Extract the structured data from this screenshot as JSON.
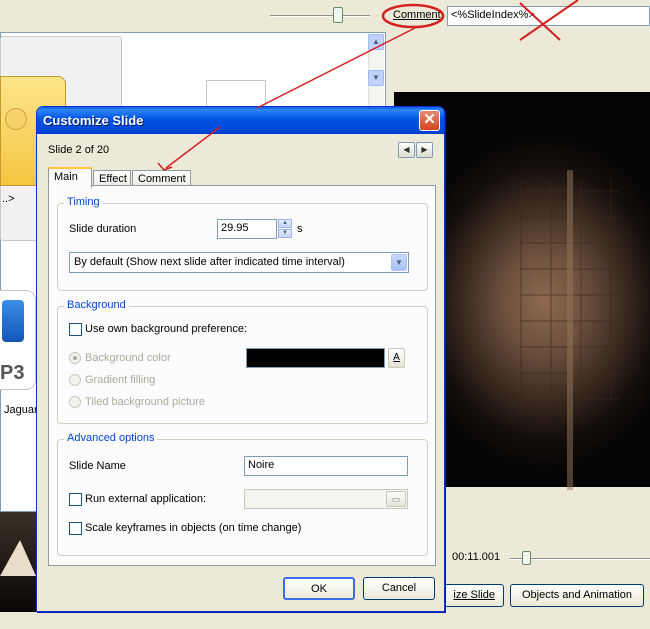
{
  "background_app": {
    "comment_label": "Comment",
    "comment_field_value": "<%SlideIndex%>",
    "thumb_label": "..>",
    "mp3_text": "P3",
    "jaguar_label": "Jaguar",
    "time_readout": "00:11.001",
    "customize_slide_button": "ize Slide",
    "objects_animation_button": "Objects and Animation"
  },
  "dialog": {
    "title": "Customize Slide",
    "close_glyph": "✕",
    "slide_counter": "Slide 2 of 20",
    "nav_prev": "◀",
    "nav_next": "▶",
    "tabs": [
      {
        "label": "Main",
        "active": true
      },
      {
        "label": "Effect",
        "active": false
      },
      {
        "label": "Comment",
        "active": false
      }
    ],
    "timing": {
      "title": "Timing",
      "duration_label": "Slide duration",
      "duration_value": "29.95",
      "duration_unit": "s",
      "mode_value": "By default (Show next slide after indicated time interval)"
    },
    "background": {
      "title": "Background",
      "own_pref_label": "Use own background preference:",
      "options": [
        "Background color",
        "Gradient filling",
        "Tiled background picture"
      ],
      "selected_option": "Background color",
      "color_value": "#000000",
      "color_button_label": "A"
    },
    "advanced": {
      "title": "Advanced options",
      "slide_name_label": "Slide Name",
      "slide_name_value": "Noire",
      "run_external_label": "Run external application:",
      "run_external_value": "",
      "scale_keyframes_label": "Scale keyframes in objects (on time change)"
    },
    "ok_label": "OK",
    "cancel_label": "Cancel"
  },
  "colors": {
    "annotation_red": "#d42020",
    "title_bar_blue": "#0054e3",
    "group_title_blue": "#0046d5"
  }
}
